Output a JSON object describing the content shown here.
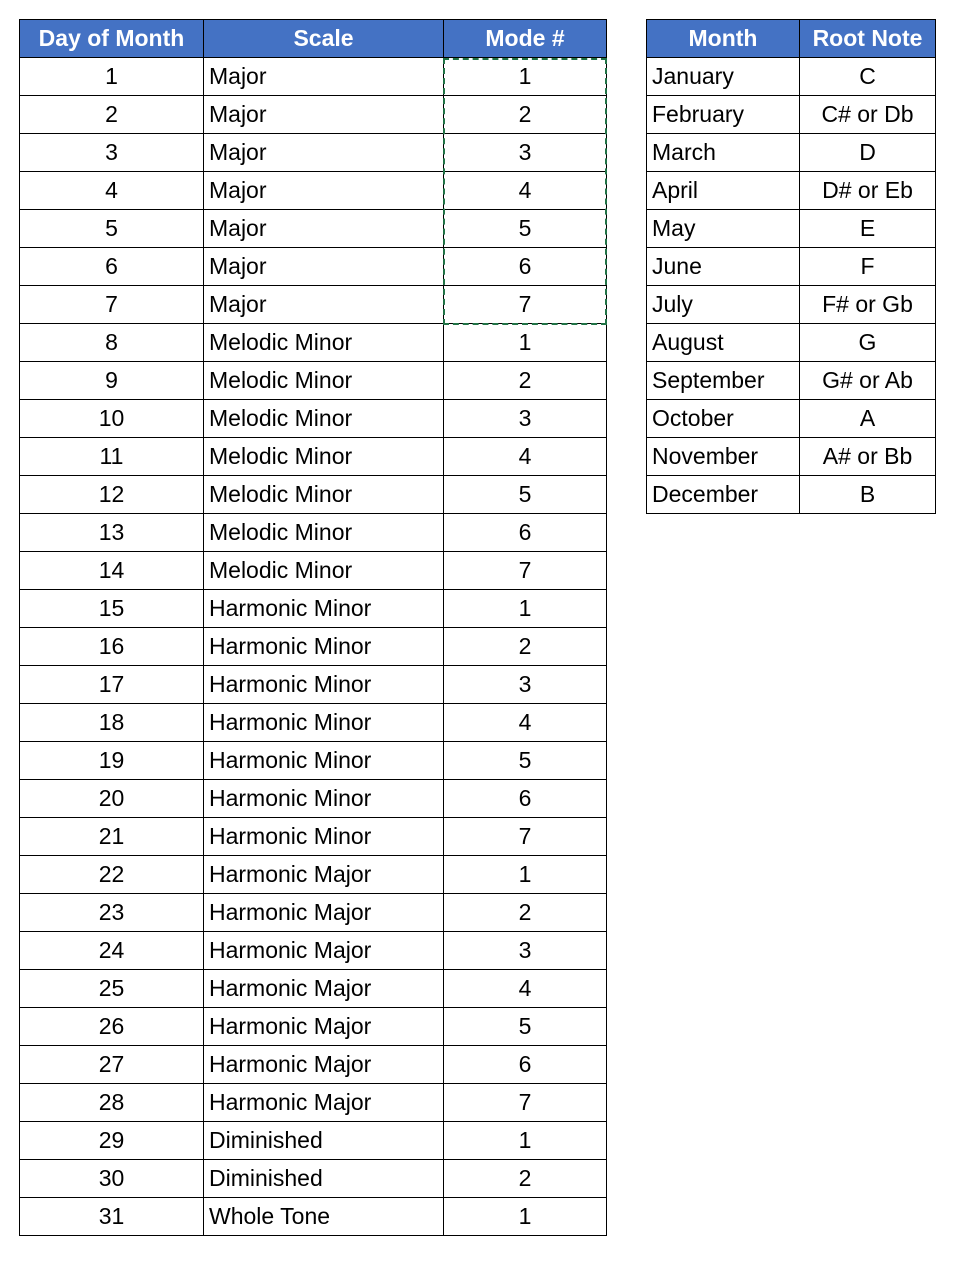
{
  "main_table": {
    "headers": [
      "Day of Month",
      "Scale",
      "Mode #"
    ],
    "rows": [
      [
        "1",
        "Major",
        "1"
      ],
      [
        "2",
        "Major",
        "2"
      ],
      [
        "3",
        "Major",
        "3"
      ],
      [
        "4",
        "Major",
        "4"
      ],
      [
        "5",
        "Major",
        "5"
      ],
      [
        "6",
        "Major",
        "6"
      ],
      [
        "7",
        "Major",
        "7"
      ],
      [
        "8",
        "Melodic Minor",
        "1"
      ],
      [
        "9",
        "Melodic Minor",
        "2"
      ],
      [
        "10",
        "Melodic Minor",
        "3"
      ],
      [
        "11",
        "Melodic Minor",
        "4"
      ],
      [
        "12",
        "Melodic Minor",
        "5"
      ],
      [
        "13",
        "Melodic Minor",
        "6"
      ],
      [
        "14",
        "Melodic Minor",
        "7"
      ],
      [
        "15",
        "Harmonic Minor",
        "1"
      ],
      [
        "16",
        "Harmonic Minor",
        "2"
      ],
      [
        "17",
        "Harmonic Minor",
        "3"
      ],
      [
        "18",
        "Harmonic Minor",
        "4"
      ],
      [
        "19",
        "Harmonic Minor",
        "5"
      ],
      [
        "20",
        "Harmonic Minor",
        "6"
      ],
      [
        "21",
        "Harmonic Minor",
        "7"
      ],
      [
        "22",
        "Harmonic Major",
        "1"
      ],
      [
        "23",
        "Harmonic Major",
        "2"
      ],
      [
        "24",
        "Harmonic Major",
        "3"
      ],
      [
        "25",
        "Harmonic Major",
        "4"
      ],
      [
        "26",
        "Harmonic Major",
        "5"
      ],
      [
        "27",
        "Harmonic Major",
        "6"
      ],
      [
        "28",
        "Harmonic Major",
        "7"
      ],
      [
        "29",
        "Diminished",
        "1"
      ],
      [
        "30",
        "Diminished",
        "2"
      ],
      [
        "31",
        "Whole Tone",
        "1"
      ]
    ]
  },
  "root_table": {
    "headers": [
      "Month",
      "Root Note"
    ],
    "rows": [
      [
        "January",
        "C"
      ],
      [
        "February",
        "C# or Db"
      ],
      [
        "March",
        "D"
      ],
      [
        "April",
        "D# or Eb"
      ],
      [
        "May",
        "E"
      ],
      [
        "June",
        "F"
      ],
      [
        "July",
        "F# or Gb"
      ],
      [
        "August",
        "G"
      ],
      [
        "September",
        "G# or Ab"
      ],
      [
        "October",
        "A"
      ],
      [
        "November",
        "A# or Bb"
      ],
      [
        "December",
        "B"
      ]
    ]
  },
  "colors": {
    "header_bg": "#4472c4",
    "selection": "#217346"
  }
}
